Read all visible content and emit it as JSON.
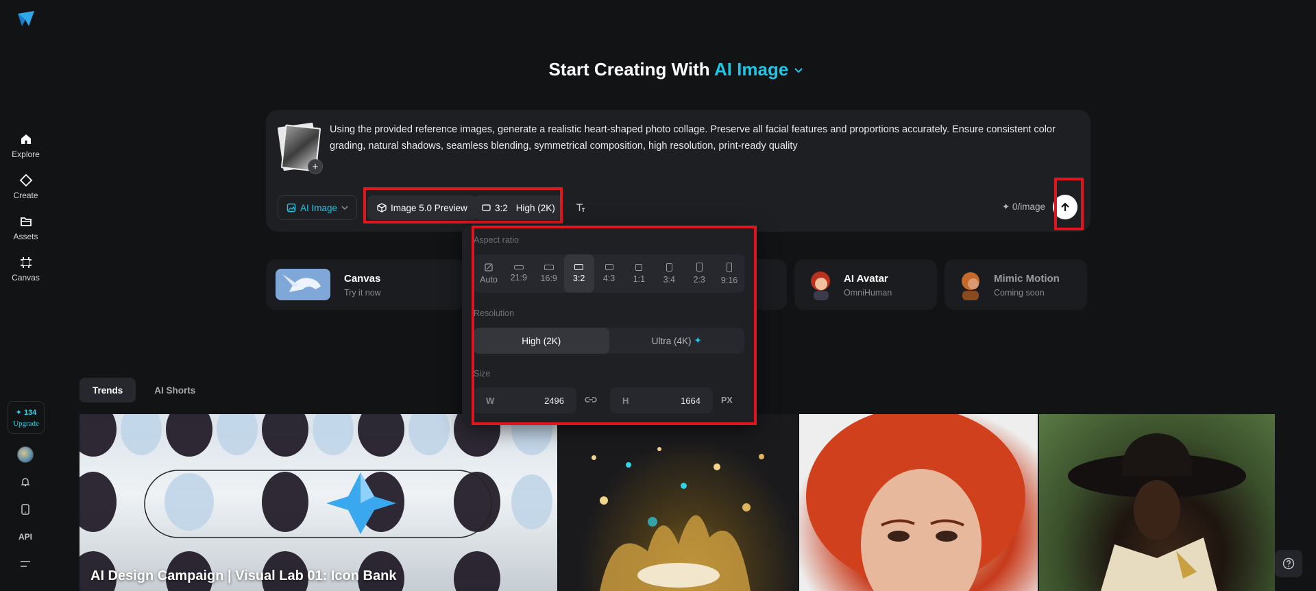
{
  "sidebar": {
    "items": [
      {
        "label": "Explore",
        "icon": "home-icon"
      },
      {
        "label": "Create",
        "icon": "diamond-icon"
      },
      {
        "label": "Assets",
        "icon": "folder-icon"
      },
      {
        "label": "Canvas",
        "icon": "canvas-icon"
      }
    ],
    "credits": {
      "count": "✦ 134",
      "upgrade": "Upgrade"
    },
    "api_label": "API"
  },
  "header": {
    "prefix": "Start Creating With",
    "mode": "AI Image"
  },
  "prompt": {
    "text": "Using the provided reference images, generate a realistic heart-shaped photo collage. Preserve all facial features and proportions accurately. Ensure consistent color grading, natural shadows, seamless blending, symmetrical composition, high resolution, print-ready quality",
    "mode_label": "AI Image",
    "model_label": "Image 5.0 Preview",
    "ratio_label": "3:2",
    "quality_label": "High (2K)",
    "cost_label": "✦ 0/image"
  },
  "features": [
    {
      "title": "Canvas",
      "subtitle": "Try it now"
    },
    {
      "title": "AI Avatar",
      "subtitle": "OmniHuman"
    },
    {
      "title": "Mimic Motion",
      "subtitle": "Coming soon"
    }
  ],
  "tabs": [
    "Trends",
    "AI Shorts"
  ],
  "gallery": {
    "title": "AI Design Campaign | Visual Lab 01: Icon Bank"
  },
  "popover": {
    "aspect_label": "Aspect ratio",
    "ratios": [
      "Auto",
      "21:9",
      "16:9",
      "3:2",
      "4:3",
      "1:1",
      "3:4",
      "2:3",
      "9:16"
    ],
    "selected_ratio": "3:2",
    "resolution_label": "Resolution",
    "resolutions": [
      "High (2K)",
      "Ultra (4K)"
    ],
    "selected_resolution": "High (2K)",
    "size_label": "Size",
    "width_key": "W",
    "width": "2496",
    "height_key": "H",
    "height": "1664",
    "unit": "PX"
  },
  "colors": {
    "accent": "#1fc5e6",
    "highlight": "#e0161e",
    "background": "#121315"
  }
}
